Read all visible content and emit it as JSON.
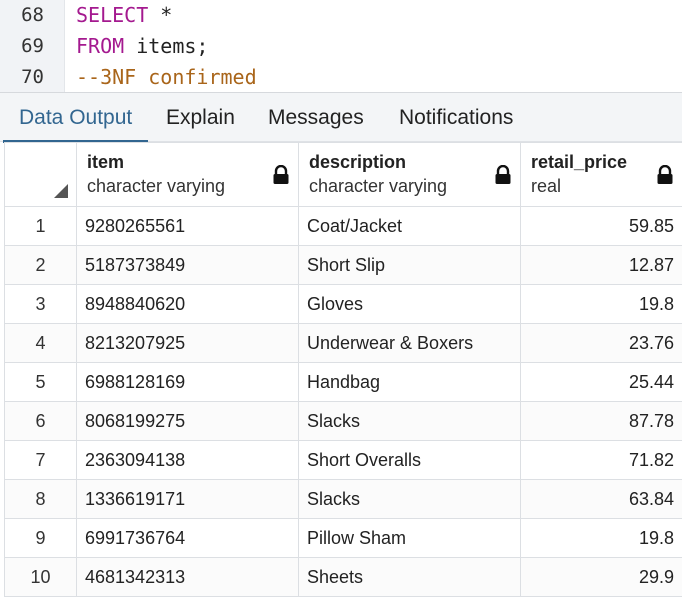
{
  "editor": {
    "lines": [
      {
        "number": "68",
        "keyword": "SELECT",
        "rest": " *"
      },
      {
        "number": "69",
        "keyword": "FROM",
        "rest": " items;"
      },
      {
        "number": "70",
        "comment": "--3NF confirmed"
      }
    ]
  },
  "tabs": [
    {
      "label": "Data Output",
      "active": true
    },
    {
      "label": "Explain",
      "active": false
    },
    {
      "label": "Messages",
      "active": false
    },
    {
      "label": "Notifications",
      "active": false
    }
  ],
  "grid": {
    "columns": [
      {
        "name": "item",
        "type": "character varying",
        "locked": true
      },
      {
        "name": "description",
        "type": "character varying",
        "locked": true
      },
      {
        "name": "retail_price",
        "type": "real",
        "locked": true
      }
    ],
    "rows": [
      {
        "n": "1",
        "item": "9280265561",
        "description": "Coat/Jacket",
        "retail_price": "59.85"
      },
      {
        "n": "2",
        "item": "5187373849",
        "description": "Short Slip",
        "retail_price": "12.87"
      },
      {
        "n": "3",
        "item": "8948840620",
        "description": "Gloves",
        "retail_price": "19.8"
      },
      {
        "n": "4",
        "item": "8213207925",
        "description": "Underwear & Boxers",
        "retail_price": "23.76"
      },
      {
        "n": "5",
        "item": "6988128169",
        "description": "Handbag",
        "retail_price": "25.44"
      },
      {
        "n": "6",
        "item": "8068199275",
        "description": "Slacks",
        "retail_price": "87.78"
      },
      {
        "n": "7",
        "item": "2363094138",
        "description": "Short Overalls",
        "retail_price": "71.82"
      },
      {
        "n": "8",
        "item": "1336619171",
        "description": "Slacks",
        "retail_price": "63.84"
      },
      {
        "n": "9",
        "item": "6991736764",
        "description": "Pillow Sham",
        "retail_price": "19.8"
      },
      {
        "n": "10",
        "item": "4681342313",
        "description": "Sheets",
        "retail_price": "29.9"
      }
    ]
  },
  "colors": {
    "keyword": "#a4198f",
    "comment": "#a9651a",
    "active_tab": "#326690"
  }
}
